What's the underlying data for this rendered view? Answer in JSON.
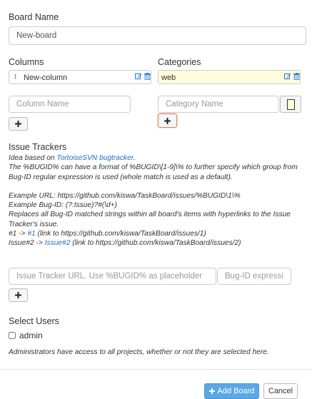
{
  "board": {
    "name_label": "Board Name",
    "name_value": "New-board"
  },
  "columns": {
    "label": "Columns",
    "items": [
      {
        "name": "New-column"
      }
    ],
    "new_placeholder": "Column Name"
  },
  "categories": {
    "label": "Categories",
    "items": [
      {
        "name": "web",
        "color": "#ffffdd"
      }
    ],
    "new_placeholder": "Category Name"
  },
  "issue_trackers": {
    "title": "Issue Trackers",
    "idea_prefix": "Idea based on ",
    "idea_link": "TortoiseSVN bugtracker",
    "idea_suffix": ".",
    "desc_1": "The %BUGID% can have a format of %BUGID\\[1-9]\\% to further specify which group from Bug-ID regular expression is used (whole match is used as a default).",
    "example_url": "Example URL: https://github.com/kiswa/TaskBoard/issues/%BUGID\\1\\%",
    "example_bugid": "Example Bug-ID: (?:Issue)?#(\\d+)",
    "replaces": "Replaces all Bug-ID matched strings within all board's items with hyperlinks to the Issue Tracker's issue.",
    "ex1_prefix": "#1 -> ",
    "ex1_link": "#1",
    "ex1_suffix": " (link to https://github.com/kiswa/TaskBoard/issues/1)",
    "ex2_prefix": "Issue#2 -> ",
    "ex2_link": "Issue#2",
    "ex2_suffix": " (link to https://github.com/kiswa/TaskBoard/issues/2)",
    "url_placeholder": "Issue Tracker URL. Use %BUGID% as placeholder",
    "bugid_placeholder": "Bug-ID expression"
  },
  "users": {
    "label": "Select Users",
    "items": [
      {
        "name": "admin",
        "checked": false
      }
    ],
    "note": "Administrators have access to all projects, whether or not they are selected here."
  },
  "footer": {
    "add_label": "Add Board",
    "cancel_label": "Cancel"
  },
  "icons": {
    "edit": "edit-icon",
    "trash": "trash-icon",
    "plus": "plus-icon",
    "drag": "drag-handle-icon"
  },
  "colors": {
    "accent": "#1a6fc9",
    "edit_icon": "#2a78d6",
    "primary_button": "#5aa9e6",
    "category_highlight_border": "#e08060"
  }
}
